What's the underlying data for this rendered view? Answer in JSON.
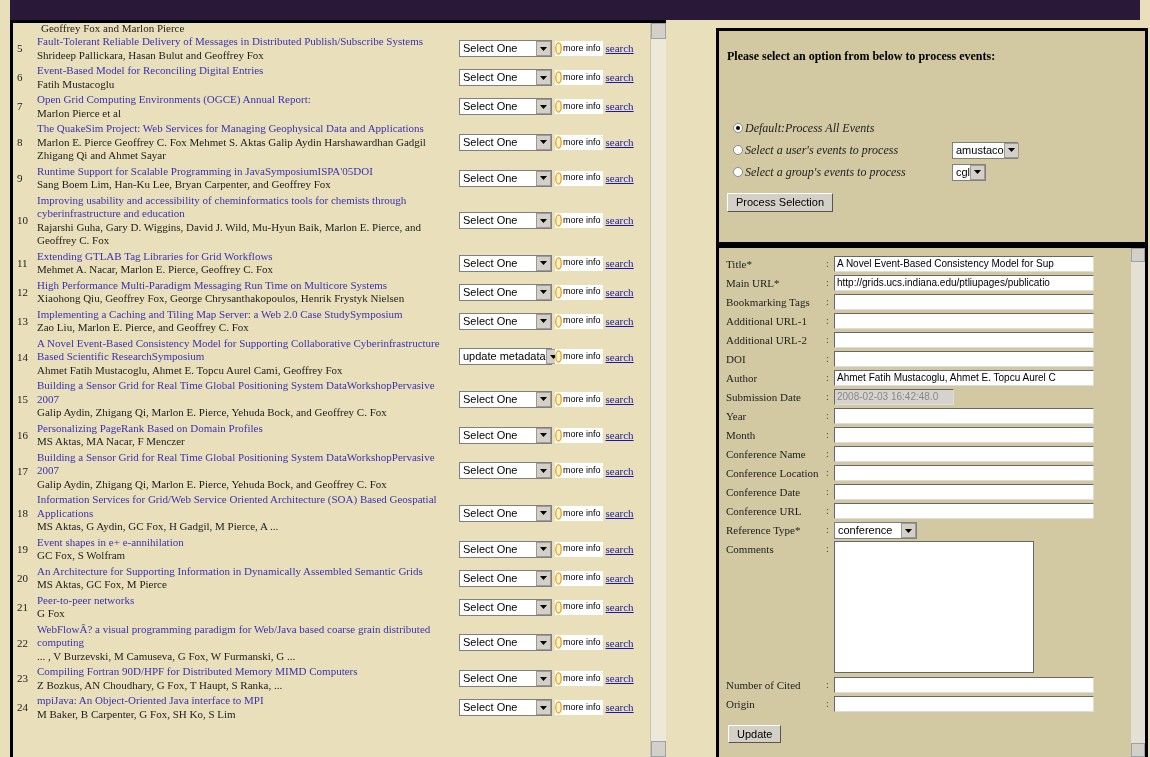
{
  "publication_list": {
    "clipped_line": "Geoffrey Fox and Marlon Pierce",
    "items": [
      {
        "number": "5",
        "title": "Fault-Tolerant Reliable Delivery of Messages in Distributed Publish/Subscribe Systems",
        "authors": "Shrideep Pallickara, Hasan Bulut and Geoffrey Fox",
        "action": "Select One",
        "more_info": "more info",
        "link": "search"
      },
      {
        "number": "6",
        "title": "Event-Based Model for Reconciling Digital Entries",
        "authors": "Fatih Mustacoglu",
        "action": "Select One",
        "more_info": "more info",
        "link": "search"
      },
      {
        "number": "7",
        "title": "Open Grid Computing Environments (OGCE) Annual Report:",
        "authors": "Marlon Pierce et al",
        "action": "Select One",
        "more_info": "more info",
        "link": "search"
      },
      {
        "number": "8",
        "title": "The QuakeSim Project: Web Services for Managing Geophysical Data and Applications",
        "authors": "Marlon E. Pierce Geoffrey C. Fox Mehmet S. Aktas Galip Aydin Harshawardhan Gadgil Zhigang Qi and Ahmet Sayar",
        "action": "Select One",
        "more_info": "more info",
        "link": "search"
      },
      {
        "number": "9",
        "title": "Runtime Support for Scalable Programming in JavaSymposiumISPA'05DOI",
        "authors": "Sang Boem Lim, Han-Ku Lee, Bryan Carpenter, and Geoffrey Fox",
        "action": "Select One",
        "more_info": "more info",
        "link": "search"
      },
      {
        "number": "10",
        "title": "Improving usability and accessibility of cheminformatics tools for chemists through cyberinfrastructure and education",
        "authors": "Rajarshi Guha, Gary D. Wiggins, David J. Wild, Mu-Hyun Baik, Marlon E. Pierce, and Geoffrey C. Fox",
        "action": "Select One",
        "more_info": "more info",
        "link": "search"
      },
      {
        "number": "11",
        "title": "Extending GTLAB Tag Libraries for Grid Workflows",
        "authors": "Mehmet A. Nacar, Marlon E. Pierce, Geoffrey C. Fox",
        "action": "Select One",
        "more_info": "more info",
        "link": "search"
      },
      {
        "number": "12",
        "title": "High Performance Multi-Paradigm Messaging Run Time on Multicore Systems",
        "authors": "Xiaohong Qiu, Geoffrey Fox, George Chrysanthakopoulos, Henrik Frystyk Nielsen",
        "action": "Select One",
        "more_info": "more info",
        "link": "search"
      },
      {
        "number": "13",
        "title": "Implementing a Caching and Tiling Map Server: a Web 2.0 Case StudySymposium",
        "authors": "Zao Liu, Marlon E. Pierce, and Geoffrey C. Fox",
        "action": "Select One",
        "more_info": "more info",
        "link": "search"
      },
      {
        "number": "14",
        "title": "A Novel Event-Based Consistency Model for Supporting Collaborative Cyberinfrastructure Based Scientific ResearchSymposium",
        "authors": "Ahmet Fatih Mustacoglu, Ahmet E. Topcu Aurel Cami, Geoffrey Fox",
        "action": "update metadata",
        "more_info": "more info",
        "link": "search"
      },
      {
        "number": "15",
        "title": "Building a Sensor Grid for Real Time Global Positioning System DataWorkshopPervasive 2007",
        "authors": "Galip Aydin, Zhigang Qi, Marlon E. Pierce, Yehuda Bock, and Geoffrey C. Fox",
        "action": "Select One",
        "more_info": "more info",
        "link": "search"
      },
      {
        "number": "16",
        "title": "Personalizing PageRank Based on Domain Profiles",
        "authors": "MS Aktas, MA Nacar, F Menczer",
        "action": "Select One",
        "more_info": "more info",
        "link": "search"
      },
      {
        "number": "17",
        "title": "Building a Sensor Grid for Real Time Global Positioning System DataWorkshopPervasive 2007",
        "authors": "Galip Aydin, Zhigang Qi, Marlon E. Pierce, Yehuda Bock, and Geoffrey C. Fox",
        "action": "Select One",
        "more_info": "more info",
        "link": "search"
      },
      {
        "number": "18",
        "title": "Information Services for Grid/Web Service Oriented Architecture (SOA) Based Geospatial Applications",
        "authors": "MS Aktas, G Aydin, GC Fox, H Gadgil, M Pierce, A ...",
        "action": "Select One",
        "more_info": "more info",
        "link": "search"
      },
      {
        "number": "19",
        "title": "Event shapes in e+ e-annihilation",
        "authors": "GC Fox, S Wolfram",
        "action": "Select One",
        "more_info": "more info",
        "link": "search"
      },
      {
        "number": "20",
        "title": "An Architecture for Supporting Information in Dynamically Assembled Semantic Grids",
        "authors": "MS Aktas, GC Fox, M Pierce",
        "action": "Select One",
        "more_info": "more info",
        "link": "search"
      },
      {
        "number": "21",
        "title": "Peer-to-peer networks",
        "authors": "G Fox",
        "action": "Select One",
        "more_info": "more info",
        "link": "search"
      },
      {
        "number": "22",
        "title": "WebFlowÂ? a visual programming paradigm for Web/Java based coarse grain distributed computing",
        "authors": "... , V Burzevski, M Camuseva, G Fox, W Furmanski, G ...",
        "action": "Select One",
        "more_info": "more info",
        "link": "search"
      },
      {
        "number": "23",
        "title": "Compiling Fortran 90D/HPF for Distributed Memory MIMD Computers",
        "authors": "Z Bozkus, AN Choudhary, G Fox, T Haupt, S Ranka, ...",
        "action": "Select One",
        "more_info": "more info",
        "link": "search"
      },
      {
        "number": "24",
        "title": "mpiJava: An Object-Oriented Java interface to MPI",
        "authors": "M Baker, B Carpenter, G Fox, SH Ko, S Lim",
        "action": "Select One",
        "more_info": "more info",
        "link": "search"
      }
    ]
  },
  "process_panel": {
    "prompt": "Please select an option from below to process events:",
    "options": [
      {
        "label": "Default:Process All Events",
        "selected": true
      },
      {
        "label": "Select a user's events to process",
        "selected": false,
        "choice": "amustaco"
      },
      {
        "label": "Select a group's events to process",
        "selected": false,
        "choice": "cgl"
      }
    ],
    "button": "Process Selection"
  },
  "metadata_form": {
    "fields": [
      {
        "label": "Title*",
        "separator": ":",
        "kind": "text",
        "value": "A Novel Event-Based Consistency Model for Sup"
      },
      {
        "label": "Main URL*",
        "separator": ":",
        "kind": "text",
        "value": "http://grids.ucs.indiana.edu/ptliupages/publicatio"
      },
      {
        "label": "Bookmarking Tags",
        "separator": ":",
        "kind": "text"
      },
      {
        "label": "Additional URL-1",
        "separator": ":",
        "kind": "text"
      },
      {
        "label": "Additional URL-2",
        "separator": ":",
        "kind": "text"
      },
      {
        "label": "DOI",
        "separator": ":",
        "kind": "text"
      },
      {
        "label": "Author",
        "separator": ":",
        "kind": "text",
        "value": "Ahmet Fatih Mustacoglu, Ahmet E. Topcu Aurel C"
      },
      {
        "label": "Submission Date",
        "separator": ":",
        "kind": "disabled",
        "value": "2008-02-03 16:42:48.0"
      },
      {
        "label": "Year",
        "separator": ":",
        "kind": "text"
      },
      {
        "label": "Month",
        "separator": ":",
        "kind": "text"
      },
      {
        "label": "Conference Name",
        "separator": ":",
        "kind": "text"
      },
      {
        "label": "Conference Location",
        "separator": ":",
        "kind": "text"
      },
      {
        "label": "Conference Date",
        "separator": ":",
        "kind": "text"
      },
      {
        "label": "Conference URL",
        "separator": ":",
        "kind": "text"
      },
      {
        "label": "Reference Type*",
        "separator": ":",
        "kind": "select",
        "value": "conference"
      },
      {
        "label": "Comments",
        "separator": ":",
        "kind": "textarea"
      },
      {
        "label": "Number of Cited",
        "separator": ":",
        "kind": "text"
      },
      {
        "label": "Origin",
        "separator": ":",
        "kind": "text"
      }
    ],
    "button": "Update"
  }
}
